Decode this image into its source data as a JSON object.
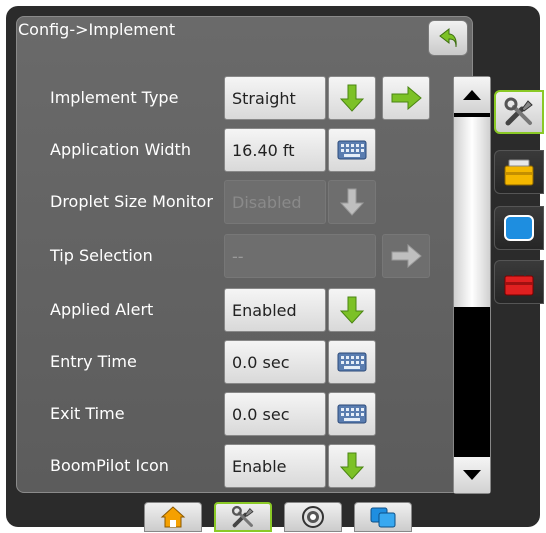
{
  "header": {
    "title": "Config->Implement"
  },
  "rows": [
    {
      "label": "Implement Type",
      "value": "Straight",
      "controls": [
        "down-arrow-button",
        "right-arrow-button"
      ]
    },
    {
      "label": "Application Width",
      "value": "16.40 ft",
      "controls": [
        "keyboard-button"
      ]
    },
    {
      "label": "Droplet Size Monitor",
      "value": "Disabled",
      "disabled": true,
      "controls": [
        "down-arrow-button"
      ]
    },
    {
      "label": "Tip Selection",
      "value": "--",
      "disabled": true,
      "controls": [
        "right-arrow-button"
      ]
    },
    {
      "label": "Applied Alert",
      "value": "Enabled",
      "controls": [
        "down-arrow-button"
      ]
    },
    {
      "label": "Entry Time",
      "value": "0.0 sec",
      "controls": [
        "keyboard-button"
      ]
    },
    {
      "label": "Exit Time",
      "value": "0.0 sec",
      "controls": [
        "keyboard-button"
      ]
    },
    {
      "label": "BoomPilot Icon",
      "value": "Enable",
      "controls": [
        "down-arrow-button"
      ]
    }
  ],
  "side_tabs": [
    {
      "icon": "tools-icon",
      "active": true
    },
    {
      "icon": "toolbox-yellow-icon",
      "active": false
    },
    {
      "icon": "monitor-blue-icon",
      "active": false
    },
    {
      "icon": "toolbox-red-icon",
      "active": false
    }
  ],
  "bottom_tabs": [
    {
      "icon": "home-icon",
      "active": false
    },
    {
      "icon": "tools-icon",
      "active": true
    },
    {
      "icon": "guidance-icon",
      "active": false
    },
    {
      "icon": "windows-icon",
      "active": false
    }
  ],
  "colors": {
    "accent_green": "#8ac926",
    "background": "#2b2b2b",
    "panel": "#626262"
  }
}
